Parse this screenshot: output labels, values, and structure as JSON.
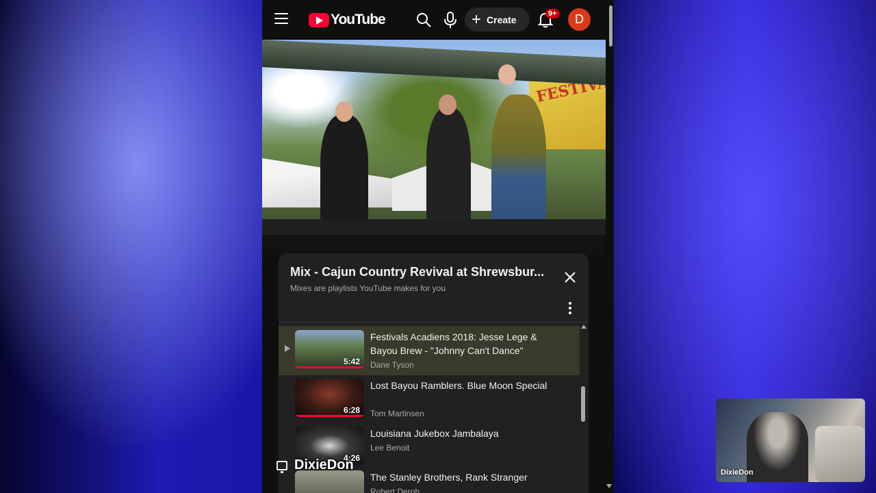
{
  "header": {
    "logo_text": "YouTube",
    "create_label": "Create",
    "notification_badge": "9+",
    "avatar_letter": "D"
  },
  "video": {
    "banner_text": "FESTIVA"
  },
  "playlist": {
    "title": "Mix - Cajun Country Revival at Shrewsbur...",
    "subtitle": "Mixes are playlists YouTube makes for you",
    "items": [
      {
        "title": "Festivals Acadiens 2018: Jesse Lege & Bayou Brew - \"Johnny Can't Dance\"",
        "channel": "Dane Tyson",
        "duration": "5:42",
        "current": true,
        "watched": true
      },
      {
        "title": "Lost Bayou Ramblers. Blue Moon Special",
        "channel": "Tom Martinsen",
        "duration": "6:28",
        "current": false,
        "watched": true
      },
      {
        "title": "Louisiana Jukebox Jambalaya",
        "channel": "Lee Benoit",
        "duration": "4:26",
        "current": false,
        "watched": false
      },
      {
        "title": "The Stanley Brothers, Rank Stranger",
        "channel": "Robert Deroh",
        "duration": "",
        "current": false,
        "watched": false
      }
    ]
  },
  "overlay": {
    "stream_name": "DixieDon"
  },
  "webcam": {
    "name": "DixieDon"
  },
  "colors": {
    "youtube_red": "#ff0033",
    "avatar": "#d93b16",
    "panel_bg": "#212121",
    "app_bg": "#0f0f0f"
  }
}
